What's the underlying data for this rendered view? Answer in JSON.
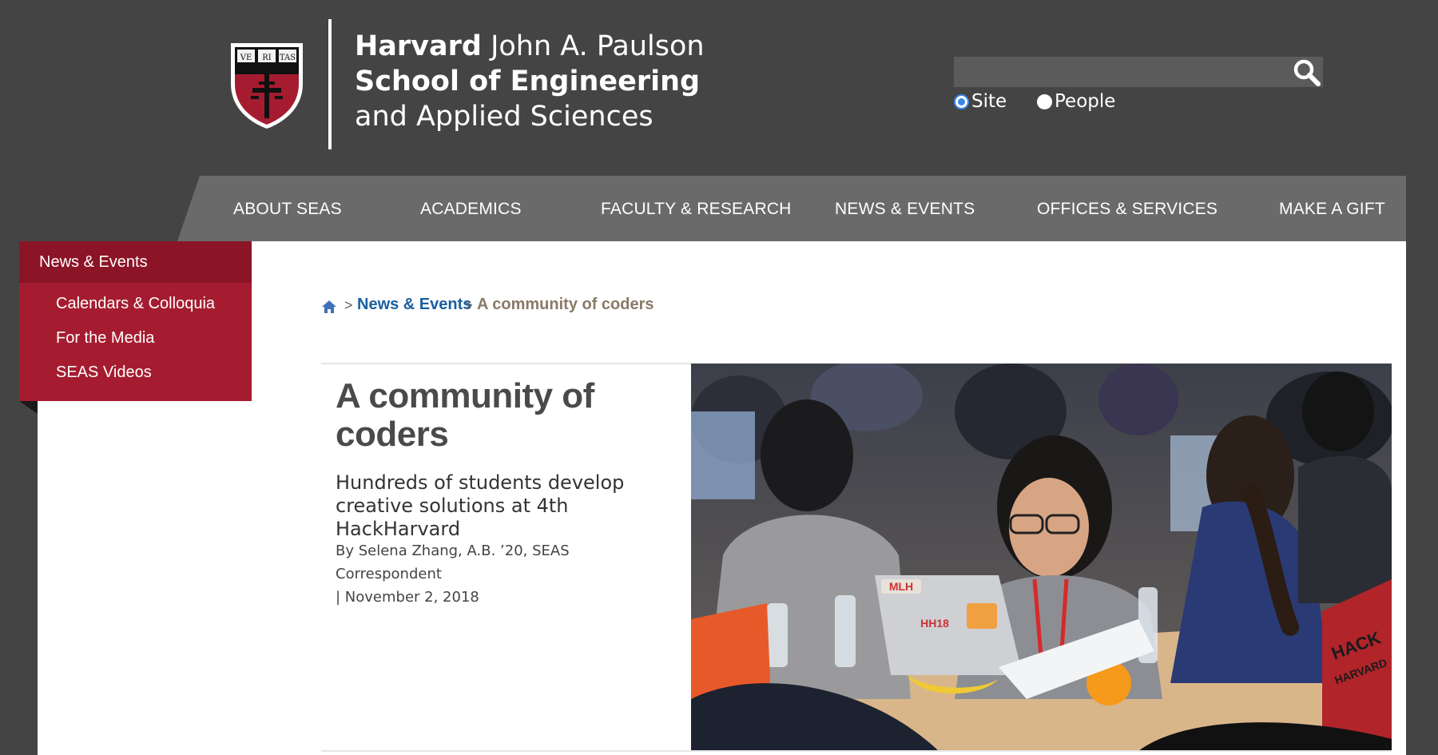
{
  "header": {
    "wordmark": {
      "harvard": "Harvard",
      "paulson": "John A. Paulson",
      "school": "School of Engineering",
      "applied": "and Applied Sciences"
    },
    "shield_text": [
      "VE",
      "RI",
      "TAS"
    ],
    "search": {
      "placeholder": ""
    },
    "scope_options": [
      {
        "label": "Site",
        "selected": true
      },
      {
        "label": "People",
        "selected": false
      }
    ]
  },
  "nav": {
    "items": [
      "ABOUT SEAS",
      "ACADEMICS",
      "FACULTY & RESEARCH",
      "NEWS & EVENTS",
      "OFFICES & SERVICES",
      "MAKE A GIFT"
    ]
  },
  "sidebar": {
    "heading": "News & Events",
    "items": [
      "Calendars & Colloquia",
      "For the Media",
      "SEAS Videos"
    ]
  },
  "breadcrumb": {
    "parent": "News & Events",
    "current": "A community of coders",
    "separator": ">"
  },
  "article": {
    "title": "A community of coders",
    "subtitle": "Hundreds of students develop creative solutions at 4th HackHarvard",
    "byline": "By Selena Zhang, A.B. ’20, SEAS Correspondent",
    "date": "| November 2, 2018"
  },
  "photo": {
    "laptop_stickers": [
      "MLH",
      "HH18"
    ],
    "background_sign": [
      "HACK",
      "HARVARD"
    ]
  },
  "colors": {
    "header_bg": "#444444",
    "nav_bg": "#6a6a6a",
    "crimson": "#a51c30",
    "crimson_dark": "#8b1426",
    "link_blue": "#1a5fa0",
    "breadcrumb_current": "#8a7a66",
    "radio_blue": "#3b87e8"
  }
}
